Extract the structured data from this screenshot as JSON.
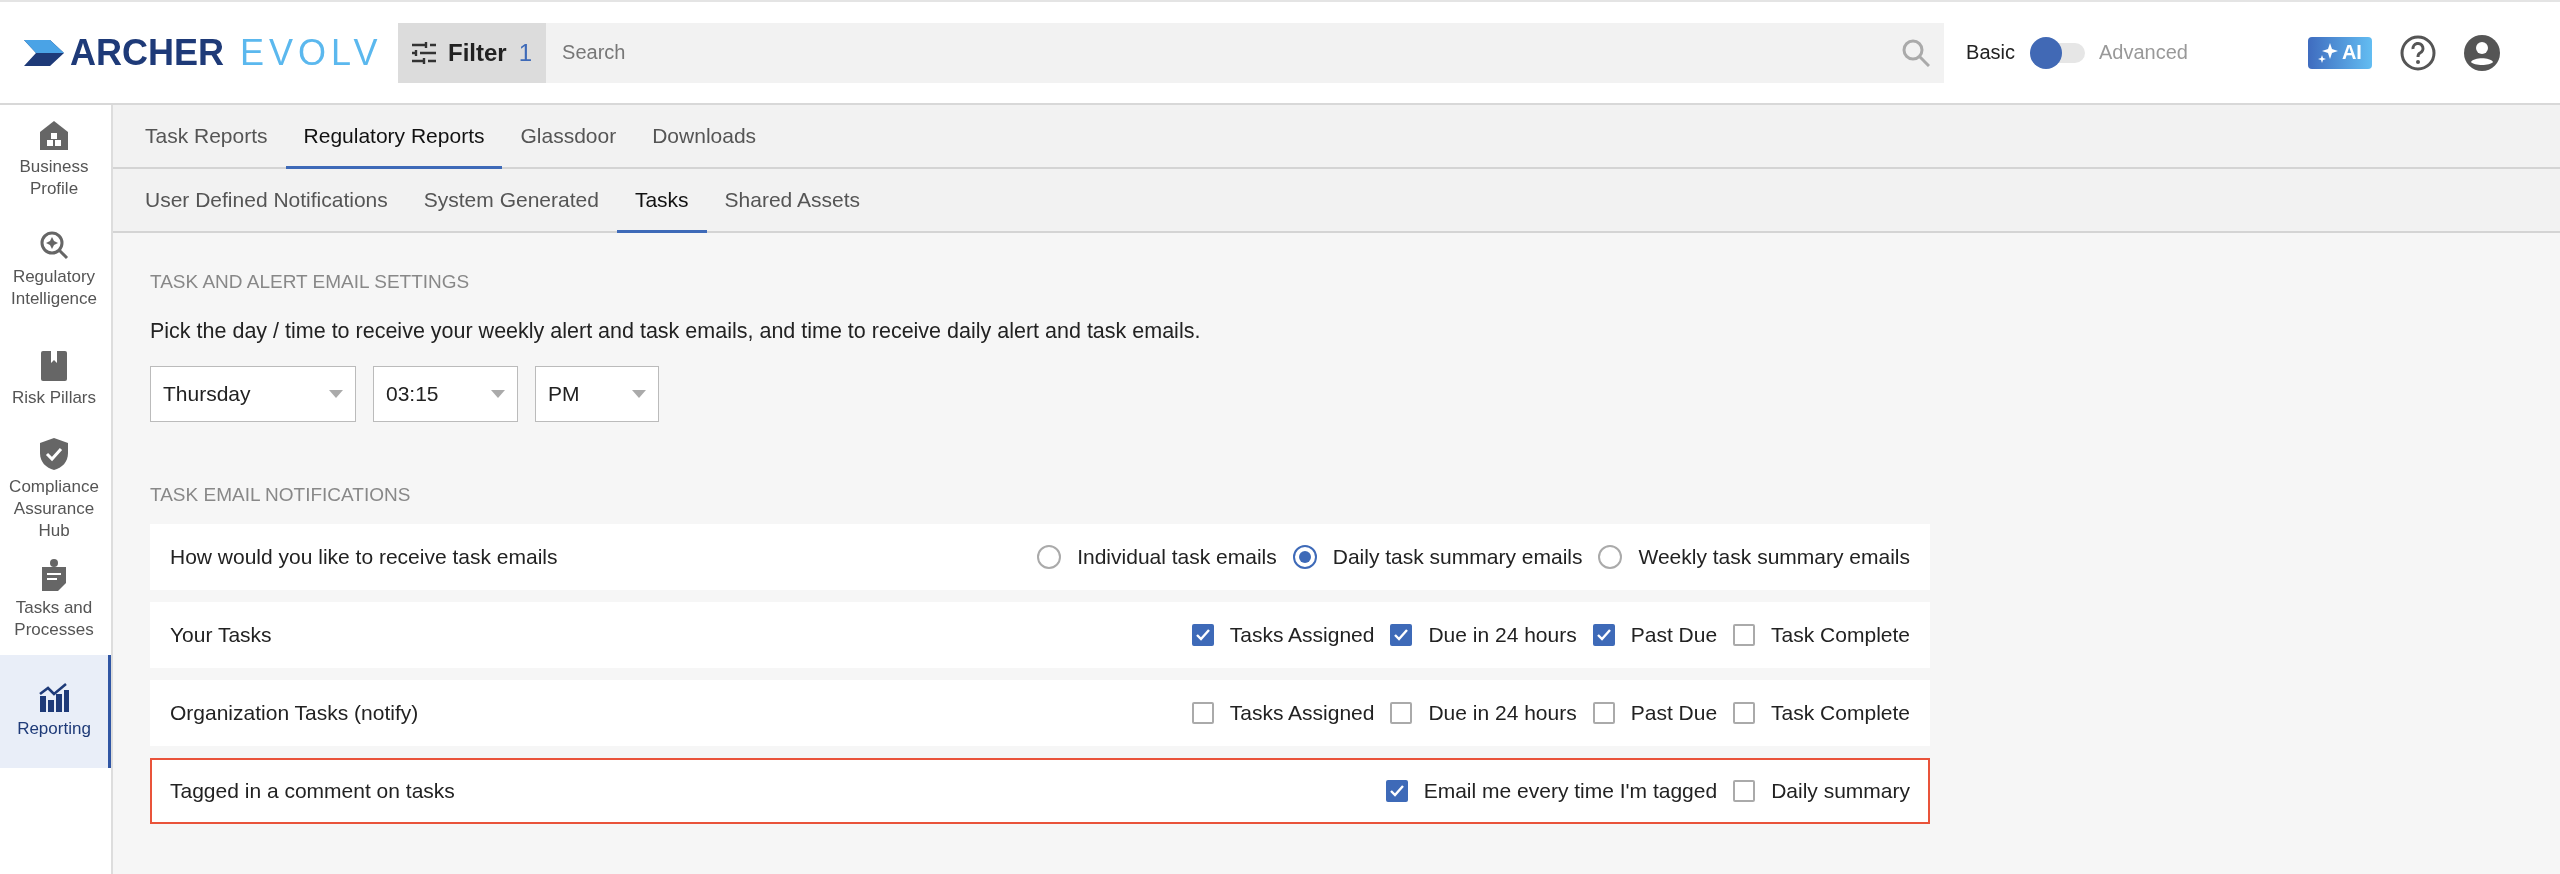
{
  "header": {
    "brand": {
      "name": "ARCHER",
      "suffix": "EVOLV"
    },
    "filter": {
      "label": "Filter",
      "count": "1"
    },
    "search": {
      "placeholder": "Search"
    },
    "mode_toggle": {
      "left": "Basic",
      "right": "Advanced",
      "on": false
    },
    "ai_button": "AI"
  },
  "sidebar": {
    "items": [
      {
        "label": "Business Profile",
        "selected": false
      },
      {
        "label": "Regulatory Intelligence",
        "selected": false
      },
      {
        "label": "Risk Pillars",
        "selected": false
      },
      {
        "label": "Compliance Assurance Hub",
        "selected": false
      },
      {
        "label": "Tasks and Processes",
        "selected": false
      },
      {
        "label": "Reporting",
        "selected": true
      }
    ]
  },
  "tabs": [
    {
      "label": "Task Reports",
      "selected": false
    },
    {
      "label": "Regulatory Reports",
      "selected": true
    },
    {
      "label": "Glassdoor",
      "selected": false
    },
    {
      "label": "Downloads",
      "selected": false
    }
  ],
  "subtabs": [
    {
      "label": "User Defined Notifications",
      "selected": false
    },
    {
      "label": "System Generated",
      "selected": false
    },
    {
      "label": "Tasks",
      "selected": true
    },
    {
      "label": "Shared Assets",
      "selected": false
    }
  ],
  "email_settings": {
    "title": "TASK AND ALERT EMAIL SETTINGS",
    "description": "Pick the day / time to receive your weekly alert and task emails, and time to receive daily alert and task emails.",
    "selects": [
      {
        "value": "Thursday"
      },
      {
        "value": "03:15"
      },
      {
        "value": "PM"
      }
    ]
  },
  "notifications": {
    "title": "TASK EMAIL NOTIFICATIONS",
    "rows": [
      {
        "label": "How would you like to receive task emails",
        "kind": "radio",
        "highlighted": false,
        "options": [
          {
            "label": "Individual task emails",
            "selected": false
          },
          {
            "label": "Daily task summary emails",
            "selected": true
          },
          {
            "label": "Weekly task summary emails",
            "selected": false
          }
        ]
      },
      {
        "label": "Your Tasks",
        "kind": "checkbox",
        "highlighted": false,
        "options": [
          {
            "label": "Tasks Assigned",
            "checked": true
          },
          {
            "label": "Due in 24 hours",
            "checked": true
          },
          {
            "label": "Past Due",
            "checked": true
          },
          {
            "label": "Task Complete",
            "checked": false
          }
        ]
      },
      {
        "label": "Organization Tasks (notify)",
        "kind": "checkbox",
        "highlighted": false,
        "options": [
          {
            "label": "Tasks Assigned",
            "checked": false
          },
          {
            "label": "Due in 24 hours",
            "checked": false
          },
          {
            "label": "Past Due",
            "checked": false
          },
          {
            "label": "Task Complete",
            "checked": false
          }
        ]
      },
      {
        "label": "Tagged in a comment on tasks",
        "kind": "checkbox",
        "highlighted": true,
        "options": [
          {
            "label": "Email me every time I'm tagged",
            "checked": true
          },
          {
            "label": "Daily summary",
            "checked": false
          }
        ]
      }
    ]
  }
}
